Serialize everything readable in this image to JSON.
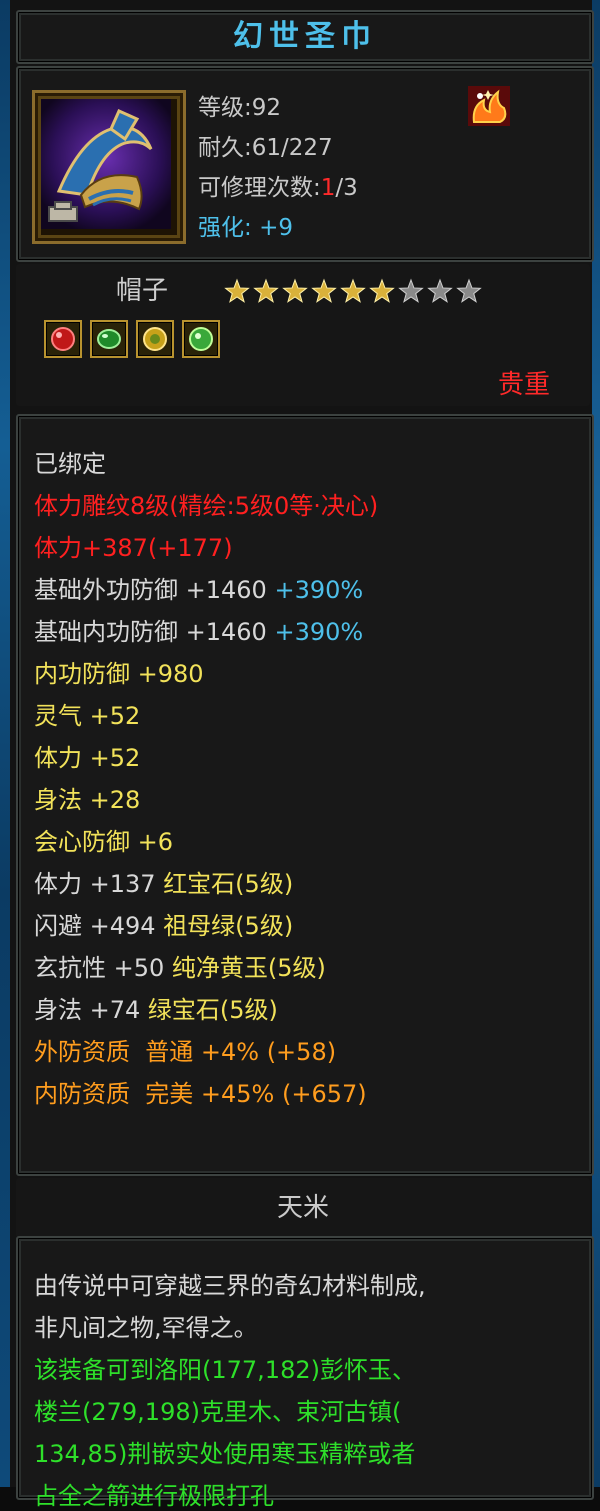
{
  "colors": {
    "title": "#4ec0ea",
    "red": "#ff2020",
    "white": "#d8d8d8",
    "yellow": "#f2e25a",
    "orange": "#ff9d1e",
    "cyan": "#4ec0ea",
    "green": "#2ee02a",
    "frame_border": "#3c4240"
  },
  "title": "幻世圣巾",
  "item_icon": "hat-item-icon",
  "badge_icon": "fire-badge-icon",
  "info": {
    "level_label": "等级",
    "level_value": ":92",
    "durability_label": "耐久",
    "durability_value": ":61/227",
    "repair_label": "可修理次数",
    "repair_colon": ":",
    "repair_used": "1",
    "repair_total": "/3",
    "enhance_label": "强化:",
    "enhance_value": "+9"
  },
  "name": "帽子",
  "stars": {
    "filled": 6,
    "total": 9
  },
  "gems": [
    "red-gem-icon",
    "green-gem-icon",
    "yellow-gem-icon",
    "green-gem-icon"
  ],
  "quality": "贵重",
  "attributes": {
    "bound": "已绑定",
    "engrave": "体力雕纹8级(精绘:5级0等·决心)",
    "stamina_total": "体力+387(+177)",
    "ext_def_label": "基础外功防御 +1460",
    "ext_def_pct": "+390%",
    "int_def_label": "基础内功防御 +1460",
    "int_def_pct": "+390%",
    "int_defense": "内功防御 +980",
    "spirit": "灵气 +52",
    "stamina": "体力 +52",
    "agility": "身法 +28",
    "crit_def": "会心防御 +6",
    "gem1_stat": "体力 +137",
    "gem1_name": "红宝石(5级)",
    "gem2_stat": "闪避 +494",
    "gem2_name": "祖母绿(5级)",
    "gem3_stat": "玄抗性 +50",
    "gem3_name": "纯净黄玉(5级)",
    "gem4_stat": "身法 +74",
    "gem4_name": "绿宝石(5级)",
    "ext_quality": "外防资质  普通 +4% (+58)",
    "int_quality": "内防资质  完美 +45% (+657)"
  },
  "subheader": "天米",
  "description": {
    "line1": "由传说中可穿越三界的奇幻材料制成,",
    "line2": "非凡间之物,罕得之。",
    "line3": "该装备可到洛阳(177,182)彭怀玉、",
    "line4": "楼兰(279,198)克里木、束河古镇(",
    "line5": "134,85)荆嵌实处使用寒玉精粹或者",
    "line6": "占全之箭进行极限打孔"
  }
}
